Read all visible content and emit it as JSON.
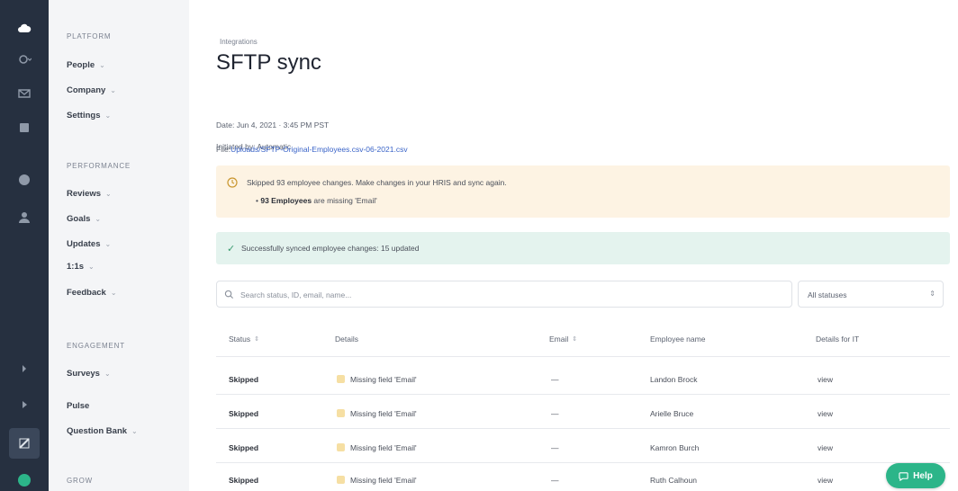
{
  "nav": {
    "sections": [
      {
        "title": "PLATFORM",
        "items": [
          "People",
          "Company",
          "Settings"
        ]
      },
      {
        "title": "PERFORMANCE",
        "items": [
          "Reviews",
          "Goals",
          "Updates",
          "1:1s",
          "Feedback"
        ]
      },
      {
        "title": "ENGAGEMENT",
        "items": [
          "Surveys",
          "Pulse",
          "Question Bank"
        ]
      },
      {
        "title": "GROW",
        "items": []
      }
    ]
  },
  "page": {
    "breadcrumb": "Integrations",
    "title": "SFTP sync",
    "date_label": "Date:",
    "date_value": "Jun 4, 2021 · 3:45 PM PST",
    "initiated_label": "Initiated by:",
    "initiated_value": "Automatic",
    "file_label": "File:",
    "file_value": "Uploads/SFTP-Original-Employees.csv-06-2021.csv"
  },
  "alerts": {
    "warning_text": "Skipped 93 employee changes. Make changes in your HRIS and sync again.",
    "warning_bullet_bold": "93 Employees",
    "warning_bullet_rest": "are missing 'Email'",
    "success_text": "Successfully synced employee changes: 15 updated"
  },
  "filters": {
    "search_placeholder": "Search status, ID, email, name...",
    "select_value": "All statuses"
  },
  "table": {
    "columns": [
      "Status",
      "Details",
      "Email",
      "Employee name",
      "Details for IT"
    ],
    "rows": [
      {
        "status": "Skipped",
        "details": "Missing field 'Email'",
        "email": "—",
        "name": "Landon Brock",
        "it": "view"
      },
      {
        "status": "Skipped",
        "details": "Missing field 'Email'",
        "email": "—",
        "name": "Arielle Bruce",
        "it": "view"
      },
      {
        "status": "Skipped",
        "details": "Missing field 'Email'",
        "email": "—",
        "name": "Kamron Burch",
        "it": "view"
      },
      {
        "status": "Skipped",
        "details": "Missing field 'Email'",
        "email": "—",
        "name": "Ruth Calhoun",
        "it": "view"
      }
    ]
  },
  "help": {
    "label": "Help"
  },
  "colors": {
    "rail": "#263040",
    "nav": "#f4f5f7",
    "warning_bg": "#fdf3e3",
    "success_bg": "#e4f3ee",
    "help": "#2cb589",
    "link": "#3a64c8"
  }
}
